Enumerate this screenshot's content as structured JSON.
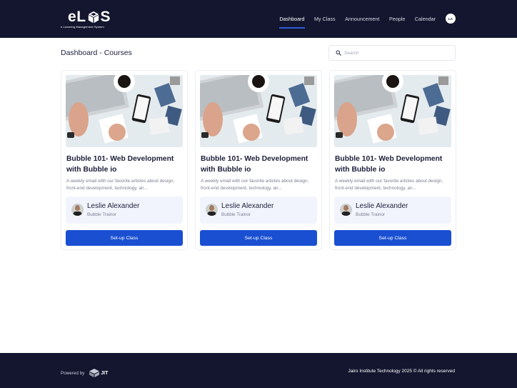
{
  "header": {
    "brand": {
      "name": "eLMS",
      "tagline": "e-Learning Management System"
    },
    "nav": [
      {
        "label": "Dashboard",
        "active": true
      },
      {
        "label": "My Class",
        "active": false
      },
      {
        "label": "Announcement",
        "active": false
      },
      {
        "label": "People",
        "active": false
      },
      {
        "label": "Calendar",
        "active": false
      }
    ],
    "user_initials": "LA"
  },
  "page": {
    "title": "Dashboard - Courses",
    "search_placeholder": "Search"
  },
  "courses": [
    {
      "title": "Bubble 101- Web Development with Bubble io",
      "description": "A weekly email with our favorite articles about design, front-end development, technology, an...",
      "trainer_name": "Leslie Alexander",
      "trainer_role": "Bubble Trainor",
      "button_label": "Set-up Class"
    },
    {
      "title": "Bubble 101- Web Development with Bubble io",
      "description": "A weekly email with our favorite articles about design, front-end development, technology, an...",
      "trainer_name": "Leslie Alexander",
      "trainer_role": "Bubble Trainor",
      "button_label": "Set-up Class"
    },
    {
      "title": "Bubble 101- Web Development with Bubble io",
      "description": "A weekly email with our favorite articles about design, front-end development, technology, an...",
      "trainer_name": "Leslie Alexander",
      "trainer_role": "Bubble Trainor",
      "button_label": "Set-up Class"
    }
  ],
  "footer": {
    "powered_by": "Powered by",
    "powered_logo": "JIT",
    "copyright": "Jairo Institute Technology 2025 © All rights reserved"
  },
  "colors": {
    "header_bg": "#13162e",
    "accent": "#1a4fd2",
    "trainer_bg": "#f2f4fd"
  },
  "icons": [
    "search-icon",
    "cube-logo-icon",
    "jit-logo-icon"
  ]
}
